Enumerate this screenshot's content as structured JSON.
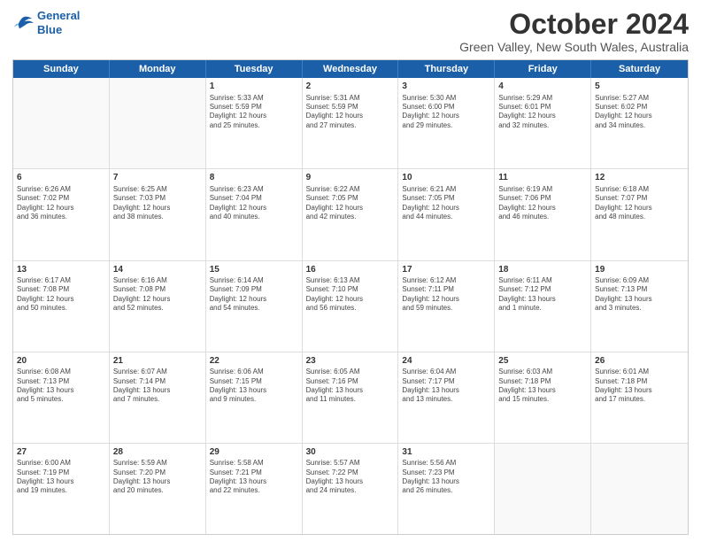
{
  "logo": {
    "line1": "General",
    "line2": "Blue"
  },
  "title": "October 2024",
  "location": "Green Valley, New South Wales, Australia",
  "days_of_week": [
    "Sunday",
    "Monday",
    "Tuesday",
    "Wednesday",
    "Thursday",
    "Friday",
    "Saturday"
  ],
  "weeks": [
    [
      {
        "day": "",
        "content": ""
      },
      {
        "day": "",
        "content": ""
      },
      {
        "day": "1",
        "content": "Sunrise: 5:33 AM\nSunset: 5:59 PM\nDaylight: 12 hours\nand 25 minutes."
      },
      {
        "day": "2",
        "content": "Sunrise: 5:31 AM\nSunset: 5:59 PM\nDaylight: 12 hours\nand 27 minutes."
      },
      {
        "day": "3",
        "content": "Sunrise: 5:30 AM\nSunset: 6:00 PM\nDaylight: 12 hours\nand 29 minutes."
      },
      {
        "day": "4",
        "content": "Sunrise: 5:29 AM\nSunset: 6:01 PM\nDaylight: 12 hours\nand 32 minutes."
      },
      {
        "day": "5",
        "content": "Sunrise: 5:27 AM\nSunset: 6:02 PM\nDaylight: 12 hours\nand 34 minutes."
      }
    ],
    [
      {
        "day": "6",
        "content": "Sunrise: 6:26 AM\nSunset: 7:02 PM\nDaylight: 12 hours\nand 36 minutes."
      },
      {
        "day": "7",
        "content": "Sunrise: 6:25 AM\nSunset: 7:03 PM\nDaylight: 12 hours\nand 38 minutes."
      },
      {
        "day": "8",
        "content": "Sunrise: 6:23 AM\nSunset: 7:04 PM\nDaylight: 12 hours\nand 40 minutes."
      },
      {
        "day": "9",
        "content": "Sunrise: 6:22 AM\nSunset: 7:05 PM\nDaylight: 12 hours\nand 42 minutes."
      },
      {
        "day": "10",
        "content": "Sunrise: 6:21 AM\nSunset: 7:05 PM\nDaylight: 12 hours\nand 44 minutes."
      },
      {
        "day": "11",
        "content": "Sunrise: 6:19 AM\nSunset: 7:06 PM\nDaylight: 12 hours\nand 46 minutes."
      },
      {
        "day": "12",
        "content": "Sunrise: 6:18 AM\nSunset: 7:07 PM\nDaylight: 12 hours\nand 48 minutes."
      }
    ],
    [
      {
        "day": "13",
        "content": "Sunrise: 6:17 AM\nSunset: 7:08 PM\nDaylight: 12 hours\nand 50 minutes."
      },
      {
        "day": "14",
        "content": "Sunrise: 6:16 AM\nSunset: 7:08 PM\nDaylight: 12 hours\nand 52 minutes."
      },
      {
        "day": "15",
        "content": "Sunrise: 6:14 AM\nSunset: 7:09 PM\nDaylight: 12 hours\nand 54 minutes."
      },
      {
        "day": "16",
        "content": "Sunrise: 6:13 AM\nSunset: 7:10 PM\nDaylight: 12 hours\nand 56 minutes."
      },
      {
        "day": "17",
        "content": "Sunrise: 6:12 AM\nSunset: 7:11 PM\nDaylight: 12 hours\nand 59 minutes."
      },
      {
        "day": "18",
        "content": "Sunrise: 6:11 AM\nSunset: 7:12 PM\nDaylight: 13 hours\nand 1 minute."
      },
      {
        "day": "19",
        "content": "Sunrise: 6:09 AM\nSunset: 7:13 PM\nDaylight: 13 hours\nand 3 minutes."
      }
    ],
    [
      {
        "day": "20",
        "content": "Sunrise: 6:08 AM\nSunset: 7:13 PM\nDaylight: 13 hours\nand 5 minutes."
      },
      {
        "day": "21",
        "content": "Sunrise: 6:07 AM\nSunset: 7:14 PM\nDaylight: 13 hours\nand 7 minutes."
      },
      {
        "day": "22",
        "content": "Sunrise: 6:06 AM\nSunset: 7:15 PM\nDaylight: 13 hours\nand 9 minutes."
      },
      {
        "day": "23",
        "content": "Sunrise: 6:05 AM\nSunset: 7:16 PM\nDaylight: 13 hours\nand 11 minutes."
      },
      {
        "day": "24",
        "content": "Sunrise: 6:04 AM\nSunset: 7:17 PM\nDaylight: 13 hours\nand 13 minutes."
      },
      {
        "day": "25",
        "content": "Sunrise: 6:03 AM\nSunset: 7:18 PM\nDaylight: 13 hours\nand 15 minutes."
      },
      {
        "day": "26",
        "content": "Sunrise: 6:01 AM\nSunset: 7:18 PM\nDaylight: 13 hours\nand 17 minutes."
      }
    ],
    [
      {
        "day": "27",
        "content": "Sunrise: 6:00 AM\nSunset: 7:19 PM\nDaylight: 13 hours\nand 19 minutes."
      },
      {
        "day": "28",
        "content": "Sunrise: 5:59 AM\nSunset: 7:20 PM\nDaylight: 13 hours\nand 20 minutes."
      },
      {
        "day": "29",
        "content": "Sunrise: 5:58 AM\nSunset: 7:21 PM\nDaylight: 13 hours\nand 22 minutes."
      },
      {
        "day": "30",
        "content": "Sunrise: 5:57 AM\nSunset: 7:22 PM\nDaylight: 13 hours\nand 24 minutes."
      },
      {
        "day": "31",
        "content": "Sunrise: 5:56 AM\nSunset: 7:23 PM\nDaylight: 13 hours\nand 26 minutes."
      },
      {
        "day": "",
        "content": ""
      },
      {
        "day": "",
        "content": ""
      }
    ]
  ]
}
